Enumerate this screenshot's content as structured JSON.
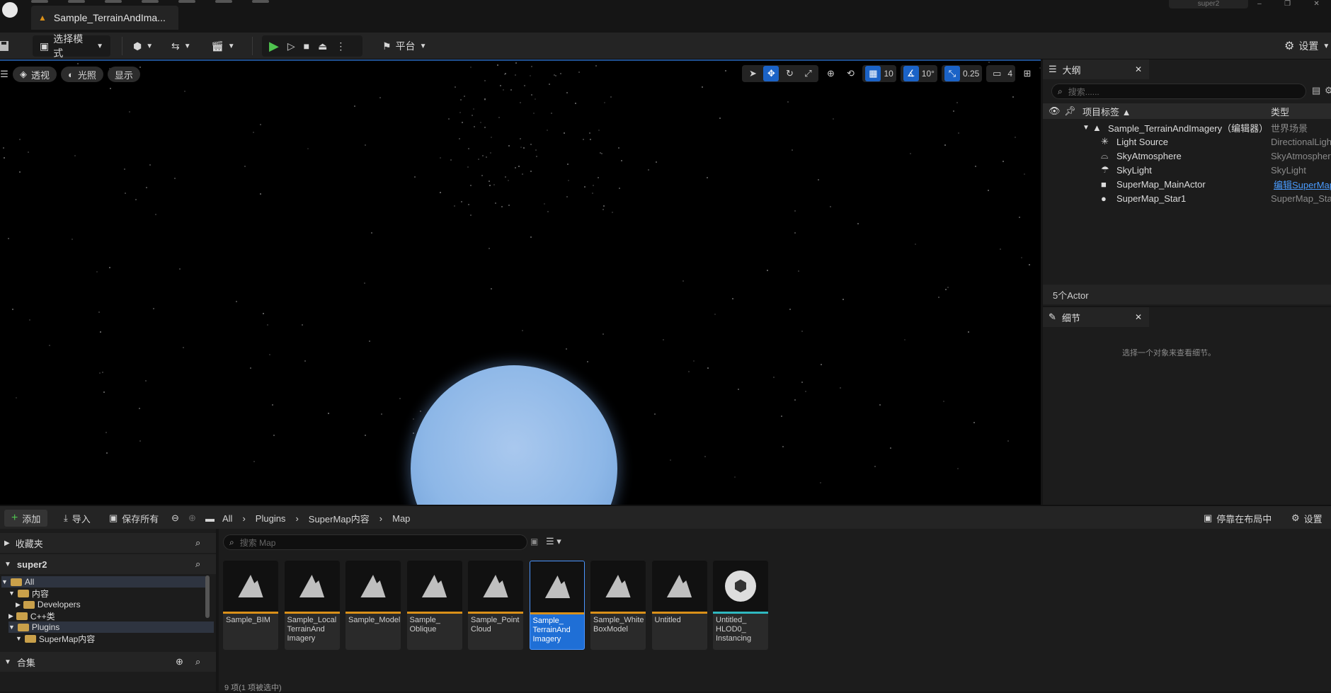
{
  "tab": {
    "title": "Sample_TerrainAndIma..."
  },
  "project": {
    "name": "super2"
  },
  "toolbar": {
    "select_mode": "选择模式",
    "platform": "平台",
    "settings": "设置"
  },
  "viewport": {
    "perspective": "透视",
    "lighting": "光照",
    "show": "显示",
    "grid_snap": "10",
    "rotation_snap": "10°",
    "scale_snap": "0.25",
    "camera_speed": "4"
  },
  "outliner": {
    "title": "大纲",
    "search_placeholder": "搜索......",
    "col_label": "项目标签",
    "col_type": "类型",
    "rows": [
      {
        "label": "Sample_TerrainAndImagery（编辑器）",
        "type": "世界场景"
      },
      {
        "label": "Light Source",
        "type": "DirectionalLigh"
      },
      {
        "label": "SkyAtmosphere",
        "type": "SkyAtmosphere"
      },
      {
        "label": "SkyLight",
        "type": "SkyLight"
      },
      {
        "label": "SuperMap_MainActor",
        "type": "编辑SuperMap"
      },
      {
        "label": "SuperMap_Star1",
        "type": "SuperMap_Sta"
      }
    ],
    "actor_count": "5个Actor"
  },
  "details": {
    "title": "细节",
    "empty_text": "选择一个对象来查看细节。"
  },
  "content_browser": {
    "add": "添加",
    "import": "导入",
    "save_all": "保存所有",
    "breadcrumb": [
      "All",
      "Plugins",
      "SuperMap内容",
      "Map"
    ],
    "dock_layout": "停靠在布局中",
    "settings": "设置",
    "favorites": "收藏夹",
    "project_root": "super2",
    "tree": [
      "All",
      "内容",
      "Developers",
      "C++类",
      "Plugins",
      "SuperMap内容"
    ],
    "collections": "合集",
    "search_placeholder": "搜索 Map",
    "assets": [
      {
        "name": "Sample_BIM"
      },
      {
        "name": "Sample_Local TerrainAnd Imagery"
      },
      {
        "name": "Sample_Model"
      },
      {
        "name": "Sample_ Oblique"
      },
      {
        "name": "Sample_Point Cloud"
      },
      {
        "name": "Sample_ TerrainAnd Imagery"
      },
      {
        "name": "Sample_White BoxModel"
      },
      {
        "name": "Untitled"
      },
      {
        "name": "Untitled_ HLOD0_ Instancing"
      }
    ],
    "item_count": "9 项(1 项被选中)"
  },
  "colors": {
    "accent": "#1b63c7",
    "map_asset": "#d99019",
    "hlod_asset": "#2fb8c0"
  }
}
